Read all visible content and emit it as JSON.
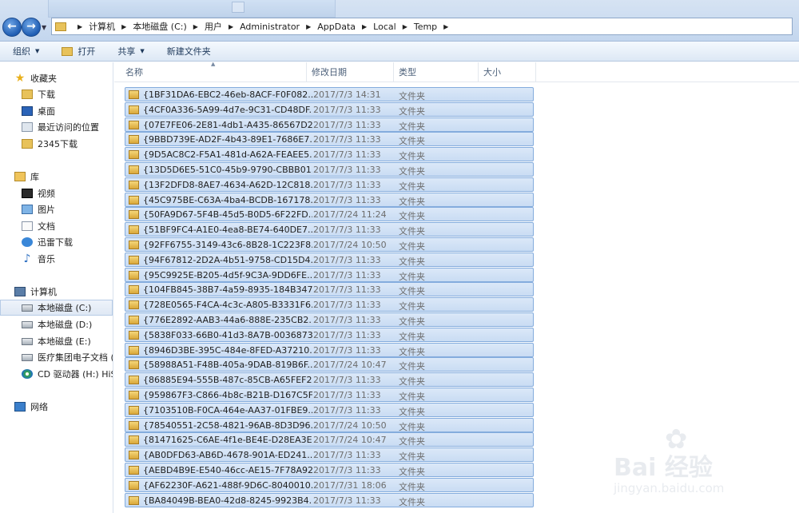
{
  "address": {
    "crumbs": [
      "计算机",
      "本地磁盘 (C:)",
      "用户",
      "Administrator",
      "AppData",
      "Local",
      "Temp"
    ],
    "background_window_title": "Diskeeper Compressed..."
  },
  "toolbar": {
    "organize": "组织",
    "open": "打开",
    "share": "共享",
    "new_folder": "新建文件夹"
  },
  "nav": {
    "favorites": "收藏夹",
    "downloads": "下载",
    "desktop": "桌面",
    "recent": "最近访问的位置",
    "downloads_2345": "2345下载",
    "libraries": "库",
    "videos": "视频",
    "pictures": "图片",
    "documents": "文档",
    "thunder": "迅雷下载",
    "music": "音乐",
    "computer": "计算机",
    "drive_c": "本地磁盘 (C:)",
    "drive_d": "本地磁盘 (D:)",
    "drive_e": "本地磁盘 (E:)",
    "drive_f": "医疗集团电子文档 (I",
    "cd": "CD 驱动器 (H:) HiSu",
    "network": "网络"
  },
  "columns": {
    "name": "名称",
    "date": "修改日期",
    "type": "类型",
    "size": "大小"
  },
  "files": [
    {
      "name": "{1BF31DA6-EBC2-46eb-8ACF-F0F082...",
      "date": "2017/7/3 14:31",
      "type": "文件夹"
    },
    {
      "name": "{4CF0A336-5A99-4d7e-9C31-CD48DF...",
      "date": "2017/7/3 11:33",
      "type": "文件夹"
    },
    {
      "name": "{07E7FE06-2E81-4db1-A435-86567D2...",
      "date": "2017/7/3 11:33",
      "type": "文件夹"
    },
    {
      "name": "{9BBD739E-AD2F-4b43-89E1-7686E7...",
      "date": "2017/7/3 11:33",
      "type": "文件夹"
    },
    {
      "name": "{9D5AC8C2-F5A1-481d-A62A-FEAEE5...",
      "date": "2017/7/3 11:33",
      "type": "文件夹"
    },
    {
      "name": "{13D5D6E5-51C0-45b9-9790-CBBB01...",
      "date": "2017/7/3 11:33",
      "type": "文件夹"
    },
    {
      "name": "{13F2DFD8-8AE7-4634-A62D-12C818...",
      "date": "2017/7/3 11:33",
      "type": "文件夹"
    },
    {
      "name": "{45C975BE-C63A-4ba4-BCDB-167178...",
      "date": "2017/7/3 11:33",
      "type": "文件夹"
    },
    {
      "name": "{50FA9D67-5F4B-45d5-B0D5-6F22FD...",
      "date": "2017/7/24 11:24",
      "type": "文件夹"
    },
    {
      "name": "{51BF9FC4-A1E0-4ea8-BE74-640DE7...",
      "date": "2017/7/3 11:33",
      "type": "文件夹"
    },
    {
      "name": "{92FF6755-3149-43c6-8B28-1C223F8...",
      "date": "2017/7/24 10:50",
      "type": "文件夹"
    },
    {
      "name": "{94F67812-2D2A-4b51-9758-CD15D4...",
      "date": "2017/7/3 11:33",
      "type": "文件夹"
    },
    {
      "name": "{95C9925E-B205-4d5f-9C3A-9DD6FE...",
      "date": "2017/7/3 11:33",
      "type": "文件夹"
    },
    {
      "name": "{104FB845-38B7-4a59-8935-184B347...",
      "date": "2017/7/3 11:33",
      "type": "文件夹"
    },
    {
      "name": "{728E0565-F4CA-4c3c-A805-B3331F6...",
      "date": "2017/7/3 11:33",
      "type": "文件夹"
    },
    {
      "name": "{776E2892-AAB3-44a6-888E-235CB2...",
      "date": "2017/7/3 11:33",
      "type": "文件夹"
    },
    {
      "name": "{5838F033-66B0-41d3-8A7B-0036873...",
      "date": "2017/7/3 11:33",
      "type": "文件夹"
    },
    {
      "name": "{8946D3BE-395C-484e-8FED-A37210...",
      "date": "2017/7/3 11:33",
      "type": "文件夹"
    },
    {
      "name": "{58988A51-F48B-405a-9DAB-819B6F...",
      "date": "2017/7/24 10:47",
      "type": "文件夹"
    },
    {
      "name": "{86885E94-555B-487c-85CB-A65FEF2...",
      "date": "2017/7/3 11:33",
      "type": "文件夹"
    },
    {
      "name": "{959867F3-C866-4b8c-B21B-D167C5F...",
      "date": "2017/7/3 11:33",
      "type": "文件夹"
    },
    {
      "name": "{7103510B-F0CA-464e-AA37-01FBE9...",
      "date": "2017/7/3 11:33",
      "type": "文件夹"
    },
    {
      "name": "{78540551-2C58-4821-96AB-8D3D96...",
      "date": "2017/7/24 10:50",
      "type": "文件夹"
    },
    {
      "name": "{81471625-C6AE-4f1e-BE4E-D28EA3E...",
      "date": "2017/7/24 10:47",
      "type": "文件夹"
    },
    {
      "name": "{AB0DFD63-AB6D-4678-901A-ED241...",
      "date": "2017/7/3 11:33",
      "type": "文件夹"
    },
    {
      "name": "{AEBD4B9E-E540-46cc-AE15-7F78A92...",
      "date": "2017/7/3 11:33",
      "type": "文件夹"
    },
    {
      "name": "{AF62230F-A621-488f-9D6C-8040010...",
      "date": "2017/7/31 18:06",
      "type": "文件夹"
    },
    {
      "name": "{BA84049B-BEA0-42d8-8245-9923B4...",
      "date": "2017/7/3 11:33",
      "type": "文件夹"
    }
  ],
  "watermark": {
    "brand": "Bai 经验",
    "url": "jingyan.baidu.com"
  },
  "colors": {
    "selection": "#cfe0f5",
    "selection_border": "#84acdd",
    "nav_bg": "#ffffff",
    "toolbar_bg": "#dde8f5"
  }
}
